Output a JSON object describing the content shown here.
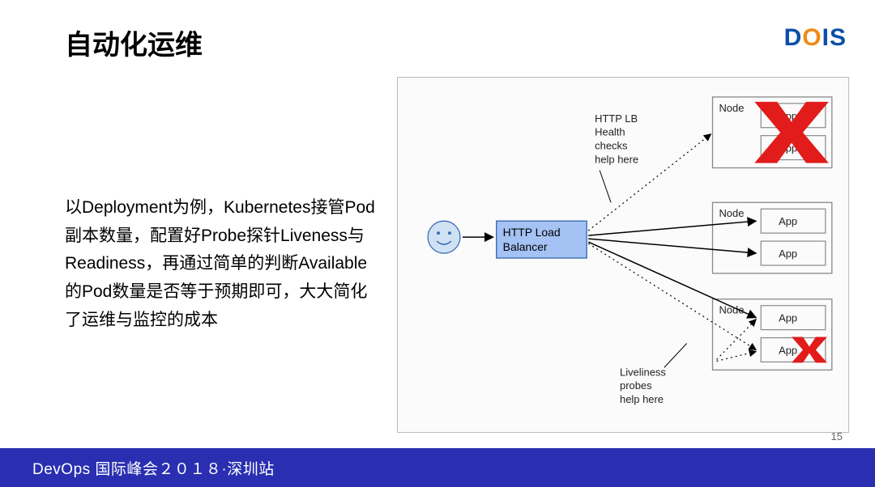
{
  "title": "自动化运维",
  "logo": {
    "d": "D",
    "o": "O",
    "i": "I",
    "s": "S"
  },
  "body": "以Deployment为例，Kubernetes接管Pod副本数量，配置好Probe探针Liveness与Readiness，再通过简单的判断Available的Pod数量是否等于预期即可，大大简化了运维与监控的成本",
  "diagram": {
    "lb_line1": "HTTP Load",
    "lb_line2": "Balancer",
    "node1": "Node",
    "node2": "Node",
    "node3": "Node",
    "app1a": "App",
    "app1b": "App",
    "app2a": "App",
    "app2b": "App",
    "app3a": "App",
    "app3b": "App",
    "annot1_l1": "HTTP LB",
    "annot1_l2": "Health",
    "annot1_l3": "checks",
    "annot1_l4": "help here",
    "annot2_l1": "Liveliness",
    "annot2_l2": "probes",
    "annot2_l3": "help here"
  },
  "footer": "DevOps 国际峰会２０１８·深圳站",
  "page_num": "15"
}
